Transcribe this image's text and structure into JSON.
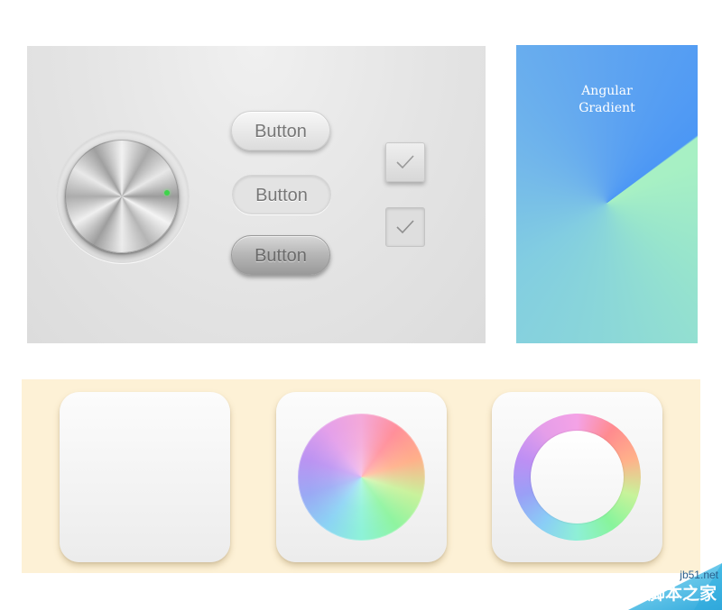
{
  "controls": {
    "buttons": [
      {
        "label": "Button",
        "style": "raised"
      },
      {
        "label": "Button",
        "style": "flat"
      },
      {
        "label": "Button",
        "style": "dark"
      }
    ],
    "checkboxes": [
      {
        "checked": true,
        "style": "raised"
      },
      {
        "checked": true,
        "style": "flat"
      }
    ],
    "knob": {
      "indicator_color": "#3fd44b"
    }
  },
  "gradient_card": {
    "title_line1": "Angular",
    "title_line2": "Gradient",
    "colors": [
      "#4c97f5",
      "#a7f0c4",
      "#82cde1"
    ]
  },
  "tiles": [
    {
      "content": "blank"
    },
    {
      "content": "color-wheel-disc"
    },
    {
      "content": "color-wheel-ring"
    }
  ],
  "colors": {
    "panel_bg": "#e4e4e4",
    "strip_bg": "#fdf1d6",
    "knob_indicator": "#3fd44b"
  },
  "watermark": {
    "site": "jb51.net",
    "brand": "脚本之家"
  }
}
